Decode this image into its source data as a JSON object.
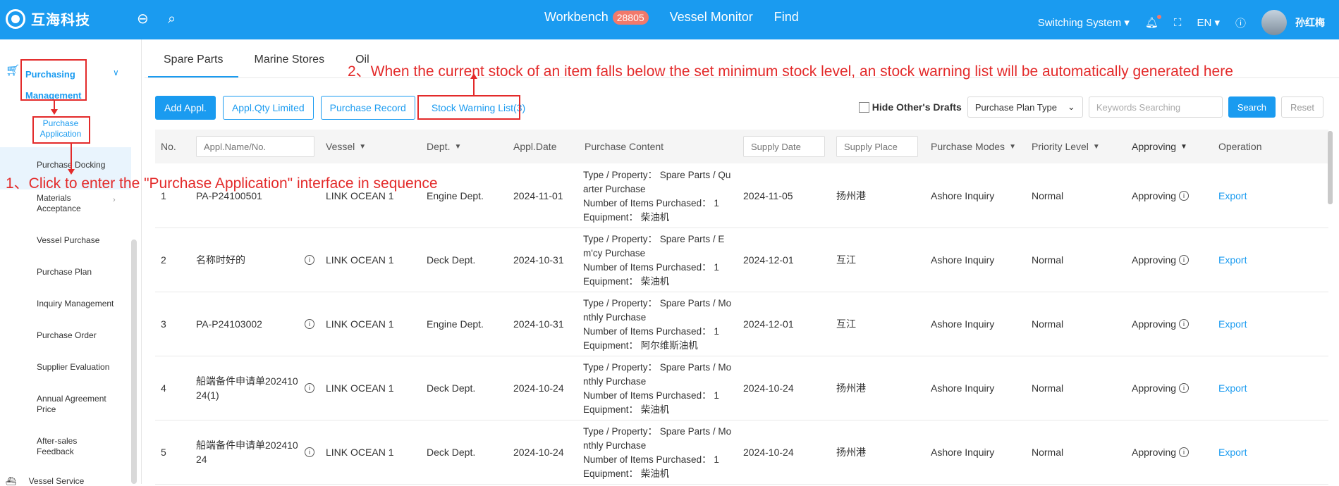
{
  "topbar": {
    "logo_text": "互海科技",
    "nav": [
      {
        "label": "Workbench",
        "badge": "28805"
      },
      {
        "label": "Vessel Monitor"
      },
      {
        "label": "Find"
      }
    ],
    "switch_system": "Switching System",
    "language": "EN",
    "user_name": "孙红梅"
  },
  "sidebar": {
    "group_label": "Purchasing Management",
    "items": [
      {
        "label": "Purchase Application",
        "active": true
      },
      {
        "label": "Purchase Docking"
      },
      {
        "label": "Materials Acceptance"
      },
      {
        "label": "Vessel Purchase"
      },
      {
        "label": "Purchase Plan"
      },
      {
        "label": "Inquiry Management"
      },
      {
        "label": "Purchase Order"
      },
      {
        "label": "Supplier Evaluation"
      },
      {
        "label": "Annual Agreement Price"
      },
      {
        "label": "After-sales Feedback"
      }
    ],
    "next_group": "Vessel Service"
  },
  "tabs": [
    "Spare Parts",
    "Marine Stores",
    "Oil"
  ],
  "toolbar": {
    "add": "Add Appl.",
    "qty_limited": "Appl.Qty Limited",
    "purchase_record": "Purchase Record",
    "stock_warning": "Stock Warning List(3)",
    "hide_drafts": "Hide Other's Drafts",
    "plan_type": "Purchase Plan Type",
    "keyword_placeholder": "Keywords Searching",
    "search": "Search",
    "reset": "Reset"
  },
  "table": {
    "headers": {
      "no": "No.",
      "name_placeholder": "Appl.Name/No.",
      "vessel": "Vessel",
      "dept": "Dept.",
      "appl_date": "Appl.Date",
      "content": "Purchase Content",
      "supply_date_placeholder": "Supply Date",
      "supply_place_placeholder": "Supply Place",
      "modes": "Purchase Modes",
      "priority": "Priority Level",
      "approving": "Approving",
      "operation": "Operation"
    },
    "rows": [
      {
        "no": "1",
        "name": "PA-P24100501",
        "vessel": "LINK OCEAN 1",
        "dept": "Engine Dept.",
        "date": "2024-11-01",
        "content": [
          "Type / Property： Spare Parts / Qu",
          "arter Purchase",
          "Number of Items Purchased： 1",
          "Equipment： 柴油机"
        ],
        "supply_date": "2024-11-05",
        "supply_place": "扬州港",
        "mode": "Ashore Inquiry",
        "priority": "Normal",
        "status": "Approving",
        "op": "Export"
      },
      {
        "no": "2",
        "name": "名称时好的",
        "vessel": "LINK OCEAN 1",
        "dept": "Deck Dept.",
        "date": "2024-10-31",
        "content": [
          "Type / Property： Spare Parts / E",
          "m'cy Purchase",
          "Number of Items Purchased： 1",
          "Equipment： 柴油机"
        ],
        "supply_date": "2024-12-01",
        "supply_place": "互江",
        "mode": "Ashore Inquiry",
        "priority": "Normal",
        "status": "Approving",
        "op": "Export"
      },
      {
        "no": "3",
        "name": "PA-P24103002",
        "vessel": "LINK OCEAN 1",
        "dept": "Engine Dept.",
        "date": "2024-10-31",
        "content": [
          "Type / Property： Spare Parts / Mo",
          "nthly Purchase",
          "Number of Items Purchased： 1",
          "Equipment： 阿尔维斯油机"
        ],
        "supply_date": "2024-12-01",
        "supply_place": "互江",
        "mode": "Ashore Inquiry",
        "priority": "Normal",
        "status": "Approving",
        "op": "Export"
      },
      {
        "no": "4",
        "name": "船端备件申请单202410 24(1)",
        "vessel": "LINK OCEAN 1",
        "dept": "Deck Dept.",
        "date": "2024-10-24",
        "content": [
          "Type / Property： Spare Parts / Mo",
          "nthly Purchase",
          "Number of Items Purchased： 1",
          "Equipment： 柴油机"
        ],
        "supply_date": "2024-10-24",
        "supply_place": "扬州港",
        "mode": "Ashore Inquiry",
        "priority": "Normal",
        "status": "Approving",
        "op": "Export"
      },
      {
        "no": "5",
        "name": "船端备件申请单202410 24",
        "vessel": "LINK OCEAN 1",
        "dept": "Deck Dept.",
        "date": "2024-10-24",
        "content": [
          "Type / Property： Spare Parts / Mo",
          "nthly Purchase",
          "Number of Items Purchased： 1",
          "Equipment： 柴油机"
        ],
        "supply_date": "2024-10-24",
        "supply_place": "扬州港",
        "mode": "Ashore Inquiry",
        "priority": "Normal",
        "status": "Approving",
        "op": "Export"
      }
    ]
  },
  "annotations": {
    "step1": "1、Click to enter the \"Purchase Application\" interface in sequence",
    "step2": "2、When the current stock of an item falls below the set minimum stock level, an stock warning list will be automatically generated here"
  },
  "colors": {
    "brand": "#1a9bf0",
    "annotation": "#e32a2a",
    "badge": "#f2796b"
  }
}
